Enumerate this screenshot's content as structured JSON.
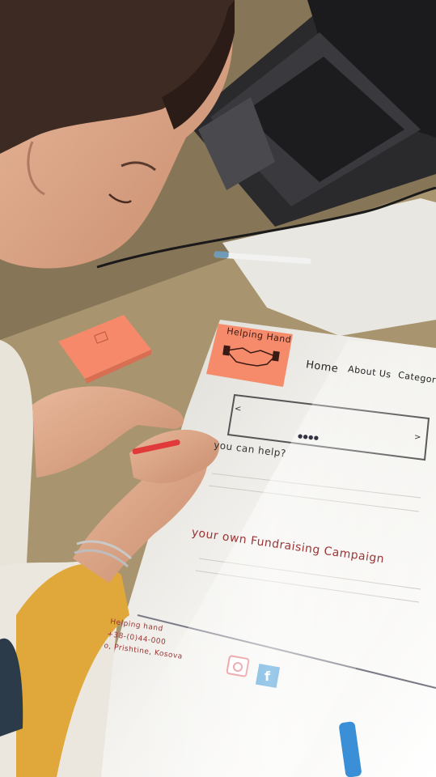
{
  "sticky_note": {
    "title": "Helping Hand"
  },
  "nav": {
    "home": "Home",
    "about": "About Us",
    "categories": "Categor"
  },
  "slider": {
    "left_arrow": "<",
    "right_arrow": ">",
    "dots": "●●●●"
  },
  "sections": {
    "help_question": "you can help?",
    "fundraising": "your own Fundraising Campaign"
  },
  "footer": {
    "org_name": "Helping hand",
    "phone": "+38-(0)44-000",
    "address": "o, Prishtine, Kosova"
  },
  "social": {
    "instagram_icon": "instagram-icon",
    "facebook_icon": "facebook-icon",
    "facebook_glyph": "f"
  },
  "colors": {
    "sticky": "#f58b6b",
    "ink_red": "#7a2f2f",
    "facebook_blue": "#2f8fd1",
    "sweater_yellow": "#e0a83a"
  }
}
